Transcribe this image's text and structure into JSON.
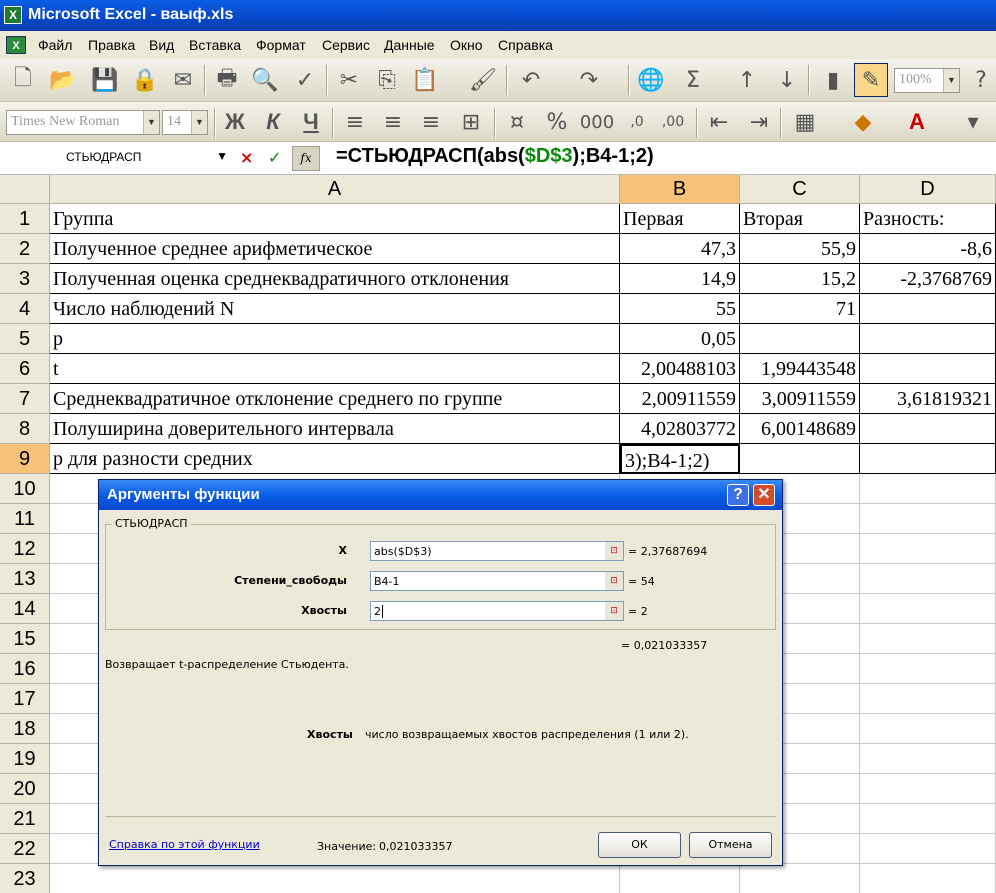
{
  "window": {
    "title": "Microsoft Excel - ваыф.xls",
    "app_icon": "excel-icon"
  },
  "menu": [
    "Файл",
    "Правка",
    "Вид",
    "Вставка",
    "Формат",
    "Сервис",
    "Данные",
    "Окно",
    "Справка"
  ],
  "toolbar": {
    "zoom": "100%",
    "font_name": "Times New Roman",
    "font_size": "14",
    "bold": "Ж",
    "italic": "К",
    "underline": "Ч",
    "percent": "%",
    "thousands": "000",
    "sigma": "Σ"
  },
  "formula_bar": {
    "name_box": "СТЬЮДРАСП",
    "cancel": "×",
    "enter": "✓",
    "fx": "fx",
    "formula_pre": "=СТЬЮДРАСП(abs(",
    "formula_ref": "$D$3",
    "formula_post": ");B4-1;2)"
  },
  "columns": [
    "A",
    "B",
    "C",
    "D"
  ],
  "rows": [
    "1",
    "2",
    "3",
    "4",
    "5",
    "6",
    "7",
    "8",
    "9",
    "10",
    "11",
    "12",
    "13",
    "14",
    "15",
    "16",
    "17",
    "18",
    "19",
    "20",
    "21",
    "22",
    "23"
  ],
  "cells": {
    "r1": [
      "Группа",
      "Первая",
      "Вторая",
      "Разность:"
    ],
    "r2": [
      "Полученное среднее арифметическое",
      "47,3",
      "55,9",
      "-8,6"
    ],
    "r3": [
      "Полученная оценка среднеквадратичного отклонения",
      "14,9",
      "15,2",
      "-2,3768769"
    ],
    "r4": [
      "Число наблюдений N",
      "55",
      "71",
      ""
    ],
    "r5": [
      "p",
      "0,05",
      "",
      ""
    ],
    "r6": [
      "t",
      "2,00488103",
      "1,99443548",
      ""
    ],
    "r7": [
      "Среднеквадратичное отклонение среднего по группе",
      "2,00911559",
      "3,00911559",
      "3,61819321"
    ],
    "r8": [
      "Полуширина доверительного интервала",
      "4,02803772",
      "6,00148689",
      ""
    ],
    "r9": [
      "p для разности средних",
      "3);B4-1;2)",
      "",
      ""
    ]
  },
  "dialog": {
    "title": "Аргументы функции",
    "help_btn": "?",
    "close_btn": "✕",
    "function_name": "СТЬЮДРАСП",
    "args": [
      {
        "label": "X",
        "value": "abs($D$3)",
        "result": "= 2,37687694"
      },
      {
        "label": "Степени_свободы",
        "value": "B4-1",
        "result": "= 54"
      },
      {
        "label": "Хвосты",
        "value": "2",
        "result": "= 2"
      }
    ],
    "total_result": "= 0,021033357",
    "description": "Возвращает t-распределение Стьюдента.",
    "arg_help_name": "Хвосты",
    "arg_help_text": "число возвращаемых хвостов распределения (1 или 2).",
    "help_link": "Справка по этой функции",
    "value_label": "Значение:",
    "value": "0,021033357",
    "ok": "ОК",
    "cancel": "Отмена"
  },
  "colors": {
    "title_blue": "#0a5ee6",
    "selected_header": "#f6c27a",
    "ref_green": "#0a8a0a",
    "link": "#0000cc"
  }
}
